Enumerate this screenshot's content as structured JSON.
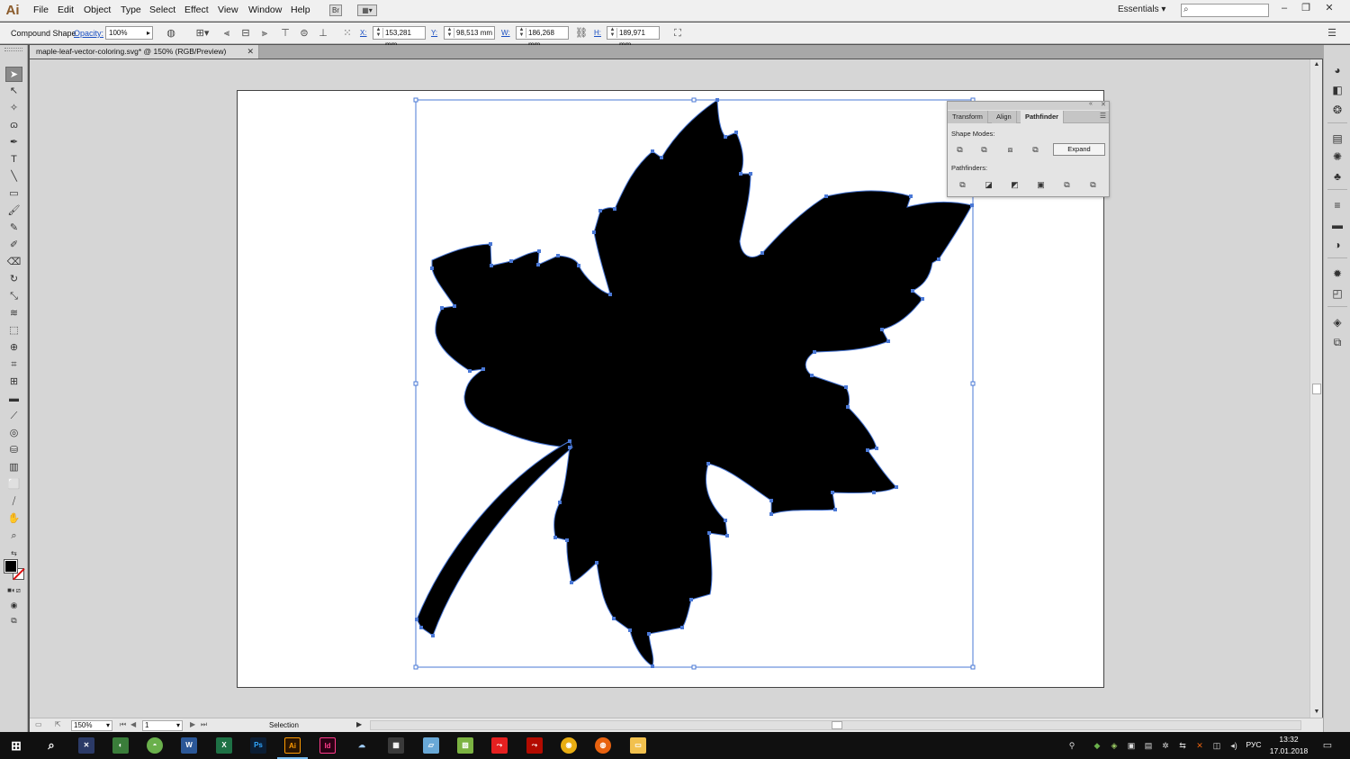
{
  "menu": {
    "logo": "Ai",
    "items": [
      "File",
      "Edit",
      "Object",
      "Type",
      "Select",
      "Effect",
      "View",
      "Window",
      "Help"
    ],
    "bridge_label": "Br",
    "workspace": "Essentials",
    "search_placeholder": ""
  },
  "control": {
    "object_type": "Compound Shape",
    "opacity_label": "Opacity:",
    "opacity_value": "100%",
    "x_label": "X:",
    "x_value": "153,281 mm",
    "y_label": "Y:",
    "y_value": "98,513 mm",
    "w_label": "W:",
    "w_value": "186,268 mm",
    "h_label": "H:",
    "h_value": "189,971 mm"
  },
  "document": {
    "tab_title": "maple-leaf-vector-coloring.svg* @ 150% (RGB/Preview)"
  },
  "pathfinder": {
    "tabs": [
      "Transform",
      "Align",
      "Pathfinder"
    ],
    "active_tab": "Pathfinder",
    "shape_modes_label": "Shape Modes:",
    "pathfinders_label": "Pathfinders:",
    "expand_label": "Expand"
  },
  "status": {
    "zoom": "150%",
    "artboard_number": "1",
    "current_tool": "Selection"
  },
  "taskbar": {
    "language": "РУС",
    "time": "13:32",
    "date": "17.01.2018",
    "apps": [
      {
        "name": "app-unknown",
        "label": ""
      },
      {
        "name": "app-paint",
        "label": ""
      },
      {
        "name": "app-green",
        "label": ""
      },
      {
        "name": "word",
        "label": "W"
      },
      {
        "name": "excel",
        "label": "X"
      },
      {
        "name": "photoshop",
        "label": "Ps"
      },
      {
        "name": "illustrator",
        "label": "Ai"
      },
      {
        "name": "indesign",
        "label": "Id"
      },
      {
        "name": "cloud",
        "label": ""
      },
      {
        "name": "calculator",
        "label": ""
      },
      {
        "name": "notes",
        "label": ""
      },
      {
        "name": "photos",
        "label": ""
      },
      {
        "name": "acrobat-dc",
        "label": ""
      },
      {
        "name": "acrobat",
        "label": ""
      },
      {
        "name": "chrome",
        "label": ""
      },
      {
        "name": "firefox",
        "label": ""
      },
      {
        "name": "explorer",
        "label": ""
      }
    ]
  },
  "colors": {
    "selection": "#4a78d6",
    "leaf_fill": "#000000",
    "illustrator_accent": "#ff9a00",
    "indesign_accent": "#ff3b8a"
  }
}
